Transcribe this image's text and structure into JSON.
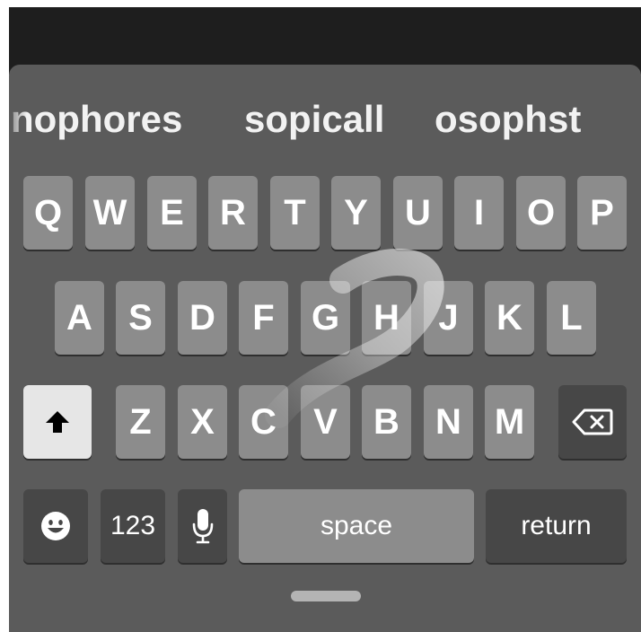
{
  "suggestions": [
    "nophores",
    "sopicall",
    "osophst"
  ],
  "keys": {
    "row1": [
      "Q",
      "W",
      "E",
      "R",
      "T",
      "Y",
      "U",
      "I",
      "O",
      "P"
    ],
    "row2": [
      "A",
      "S",
      "D",
      "F",
      "G",
      "H",
      "J",
      "K",
      "L"
    ],
    "row3": [
      "Z",
      "X",
      "C",
      "V",
      "B",
      "N",
      "M"
    ]
  },
  "bottom_row": {
    "emoji_icon": "smiley-icon",
    "numbers_label": "123",
    "mic_icon": "microphone-icon",
    "space_label": "space",
    "return_label": "return"
  },
  "icons": {
    "shift": "shift-arrow-icon",
    "delete": "backspace-icon"
  },
  "colors": {
    "keyboard_bg": "#5b5b5b",
    "key": "#8c8c8c",
    "key_dark": "#474747",
    "shift_active": "#e6e6e6"
  }
}
